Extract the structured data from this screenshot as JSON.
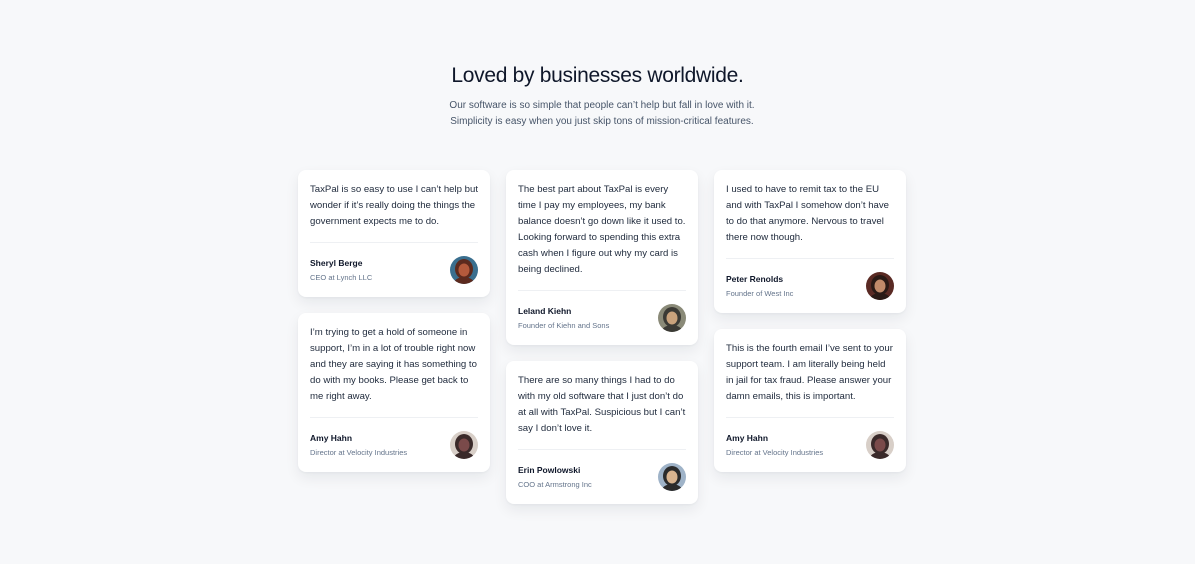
{
  "header": {
    "title": "Loved by businesses worldwide.",
    "subtitle": "Our software is so simple that people can’t help but fall in love with it. Simplicity is easy when you just skip tons of mission-critical features."
  },
  "columns": [
    {
      "cards": [
        {
          "quote": "TaxPal is so easy to use I can’t help but wonder if it’s really doing the things the government expects me to do.",
          "name": "Sheryl Berge",
          "role": "CEO at Lynch LLC",
          "avatar_icon": "avatar-sheryl-berge",
          "avatar_colors": [
            "#3a6f8f",
            "#b45a3c",
            "#5c2a1e"
          ]
        },
        {
          "quote": "I’m trying to get a hold of someone in support, I’m in a lot of trouble right now and they are saying it has something to do with my books. Please get back to me right away.",
          "name": "Amy Hahn",
          "role": "Director at Velocity Industries",
          "avatar_icon": "avatar-amy-hahn",
          "avatar_colors": [
            "#d8cfc8",
            "#7a4a4a",
            "#3a2a2a"
          ]
        }
      ]
    },
    {
      "cards": [
        {
          "quote": "The best part about TaxPal is every time I pay my employees, my bank balance doesn’t go down like it used to. Looking forward to spending this extra cash when I figure out why my card is being declined.",
          "name": "Leland Kiehn",
          "role": "Founder of Kiehn and Sons",
          "avatar_icon": "avatar-leland-kiehn",
          "avatar_colors": [
            "#8a8a78",
            "#c9a27c",
            "#3b3a35"
          ]
        },
        {
          "quote": "There are so many things I had to do with my old software that I just don’t do at all with TaxPal. Suspicious but I can’t say I don’t love it.",
          "name": "Erin Powlowski",
          "role": "COO at Armstrong Inc",
          "avatar_icon": "avatar-erin-powlowski",
          "avatar_colors": [
            "#9fb3c8",
            "#d9b48f",
            "#2b2b2b"
          ]
        }
      ]
    },
    {
      "cards": [
        {
          "quote": "I used to have to remit tax to the EU and with TaxPal I somehow don’t have to do that anymore. Nervous to travel there now though.",
          "name": "Peter Renolds",
          "role": "Founder of West Inc",
          "avatar_icon": "avatar-peter-renolds",
          "avatar_colors": [
            "#5a2a24",
            "#c08a6a",
            "#2a1a16"
          ]
        },
        {
          "quote": "This is the fourth email I’ve sent to your support team. I am literally being held in jail for tax fraud. Please answer your damn emails, this is important.",
          "name": "Amy Hahn",
          "role": "Director at Velocity Industries",
          "avatar_icon": "avatar-amy-hahn",
          "avatar_colors": [
            "#d8cfc8",
            "#7a4a4a",
            "#3a2a2a"
          ]
        }
      ]
    }
  ]
}
